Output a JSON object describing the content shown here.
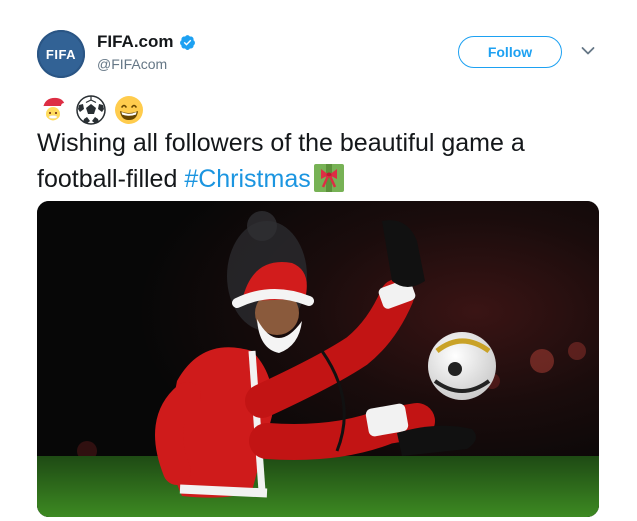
{
  "account": {
    "display_name": "FIFA.com",
    "handle": "@FIFAcom",
    "avatar_text": "FIFA",
    "verified": true
  },
  "actions": {
    "follow_label": "Follow",
    "menu_icon": "chevron-down-icon"
  },
  "tweet": {
    "emojis": [
      "santa-emoji",
      "soccer-ball-emoji",
      "grinning-face-emoji"
    ],
    "text_before": "Wishing all followers of the beautiful game a football-filled ",
    "hashtag": "#Christmas",
    "trailing_emoji": "gift-icon"
  },
  "media": {
    "type": "photo",
    "description_icon": "santa-footballer-photo"
  },
  "colors": {
    "accent": "#1da1f2",
    "hashtag": "#1b95e0",
    "text": "#14171a",
    "muted": "#657786",
    "avatar_bg": "#326295"
  }
}
